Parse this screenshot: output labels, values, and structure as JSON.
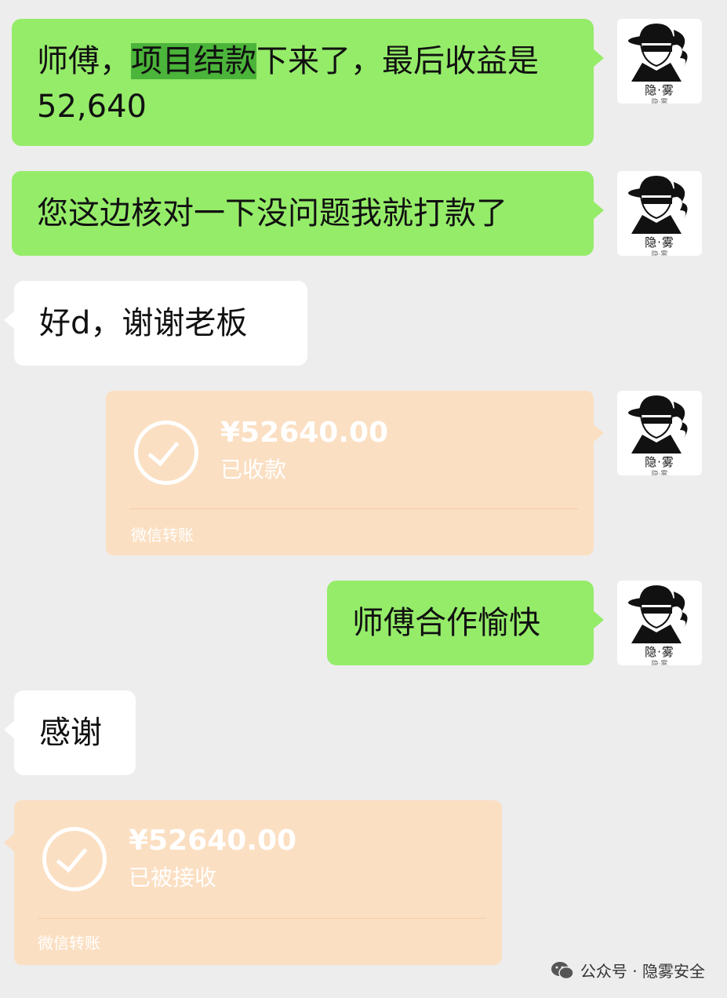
{
  "messages": [
    {
      "side": "right",
      "pre": "师傅，",
      "highlight": "项目结款",
      "post": "下来了，最后收益是52,640"
    },
    {
      "side": "right",
      "text": "您这边核对一下没问题我就打款了"
    },
    {
      "side": "left",
      "text": "好d，谢谢老板"
    },
    {
      "side": "right",
      "type": "transfer",
      "amount": "¥52640.00",
      "status": "已收款",
      "brand": "微信转账"
    },
    {
      "side": "right",
      "text": "师傅合作愉快"
    },
    {
      "side": "left",
      "text": "感谢"
    },
    {
      "side": "left",
      "type": "transfer",
      "amount": "¥52640.00",
      "status": "已被接收",
      "brand": "微信转账"
    }
  ],
  "avatar": {
    "name": "隐·雾",
    "icon": "spy-hat-avatar-icon"
  },
  "footer": {
    "label": "公众号 · 隐雾安全",
    "icon": "wechat-icon"
  },
  "colors": {
    "background": "#ededed",
    "self_bubble": "#95ec69",
    "other_bubble": "#ffffff",
    "transfer_card": "#fbdfc2",
    "highlight": "#4bb43a"
  }
}
